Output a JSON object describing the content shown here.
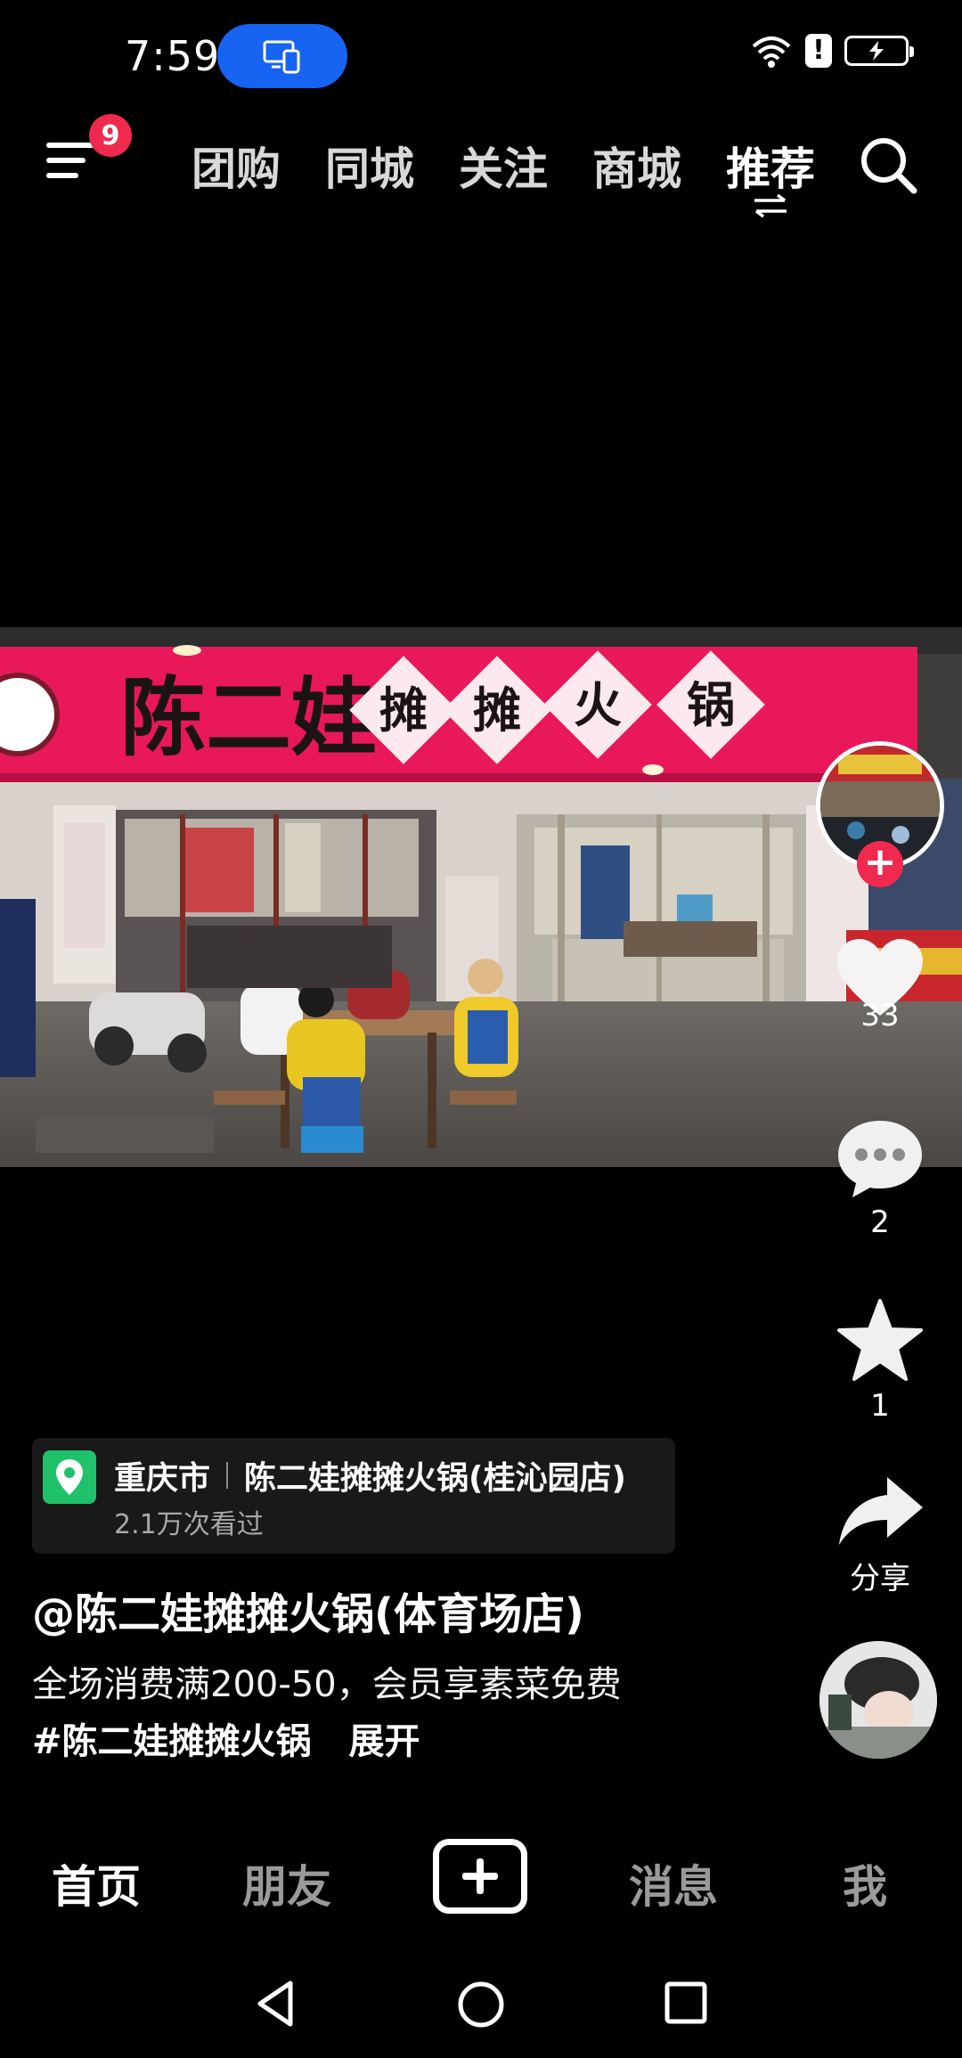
{
  "status_bar": {
    "time": "7:59"
  },
  "top_nav": {
    "notification_badge": "9",
    "tabs": [
      {
        "label": "团购",
        "active": false
      },
      {
        "label": "同城",
        "active": false
      },
      {
        "label": "关注",
        "active": false
      },
      {
        "label": "商城",
        "active": false
      },
      {
        "label": "推荐",
        "active": true
      }
    ]
  },
  "video": {
    "sign_text": "陈二娃",
    "sign_tiles": [
      "摊",
      "摊",
      "火",
      "锅"
    ]
  },
  "right_rail": {
    "likes": "33",
    "comments": "2",
    "favorites": "1",
    "share_label": "分享"
  },
  "poi": {
    "city": "重庆市",
    "place": "陈二娃摊摊火锅(桂沁园店)",
    "views": "2.1万次看过"
  },
  "post": {
    "author": "@陈二娃摊摊火锅(体育场店)",
    "description": "全场消费满200-50，会员享素菜免费",
    "hashtag": "#陈二娃摊摊火锅",
    "expand_label": "展开"
  },
  "bottom_nav": {
    "home": "首页",
    "friends": "朋友",
    "messages": "消息",
    "me": "我"
  },
  "colors": {
    "accent_red": "#f0294f",
    "status_pill_blue": "#1763f2",
    "poi_green": "#1fc16b"
  },
  "icons": [
    "menu-icon",
    "search-icon",
    "heart-icon",
    "comment-icon",
    "star-icon",
    "share-icon",
    "location-pin-icon",
    "plus-icon",
    "back-triangle-icon",
    "home-circle-icon",
    "recents-square-icon"
  ]
}
